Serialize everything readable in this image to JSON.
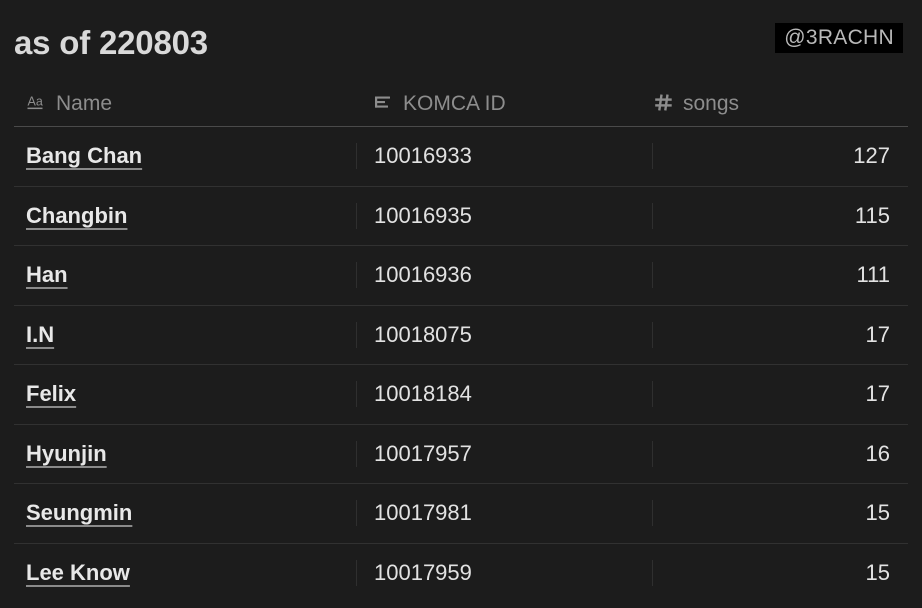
{
  "header": {
    "title": "as of 220803",
    "watermark": "@3RACHN"
  },
  "table": {
    "columns": [
      {
        "label": "Name",
        "icon": "text-aa-icon"
      },
      {
        "label": "KOMCA ID",
        "icon": "text-lines-icon"
      },
      {
        "label": "songs",
        "icon": "hash-number-icon"
      }
    ],
    "rows": [
      {
        "name": "Bang Chan",
        "komca_id": "10016933",
        "songs": "127"
      },
      {
        "name": "Changbin",
        "komca_id": "10016935",
        "songs": "115"
      },
      {
        "name": "Han",
        "komca_id": "10016936",
        "songs": "111"
      },
      {
        "name": "I.N",
        "komca_id": "10018075",
        "songs": "17"
      },
      {
        "name": "Felix",
        "komca_id": "10018184",
        "songs": "17"
      },
      {
        "name": "Hyunjin",
        "komca_id": "10017957",
        "songs": "16"
      },
      {
        "name": "Seungmin",
        "komca_id": "10017981",
        "songs": "15"
      },
      {
        "name": "Lee Know",
        "komca_id": "10017959",
        "songs": "15"
      }
    ]
  },
  "colors": {
    "background": "#1c1c1c",
    "watermark_background": "#000000",
    "text_primary": "#e8e8e8",
    "text_muted": "#8d8d8d",
    "rule": "#313131",
    "header_rule": "#4a4a4a"
  }
}
